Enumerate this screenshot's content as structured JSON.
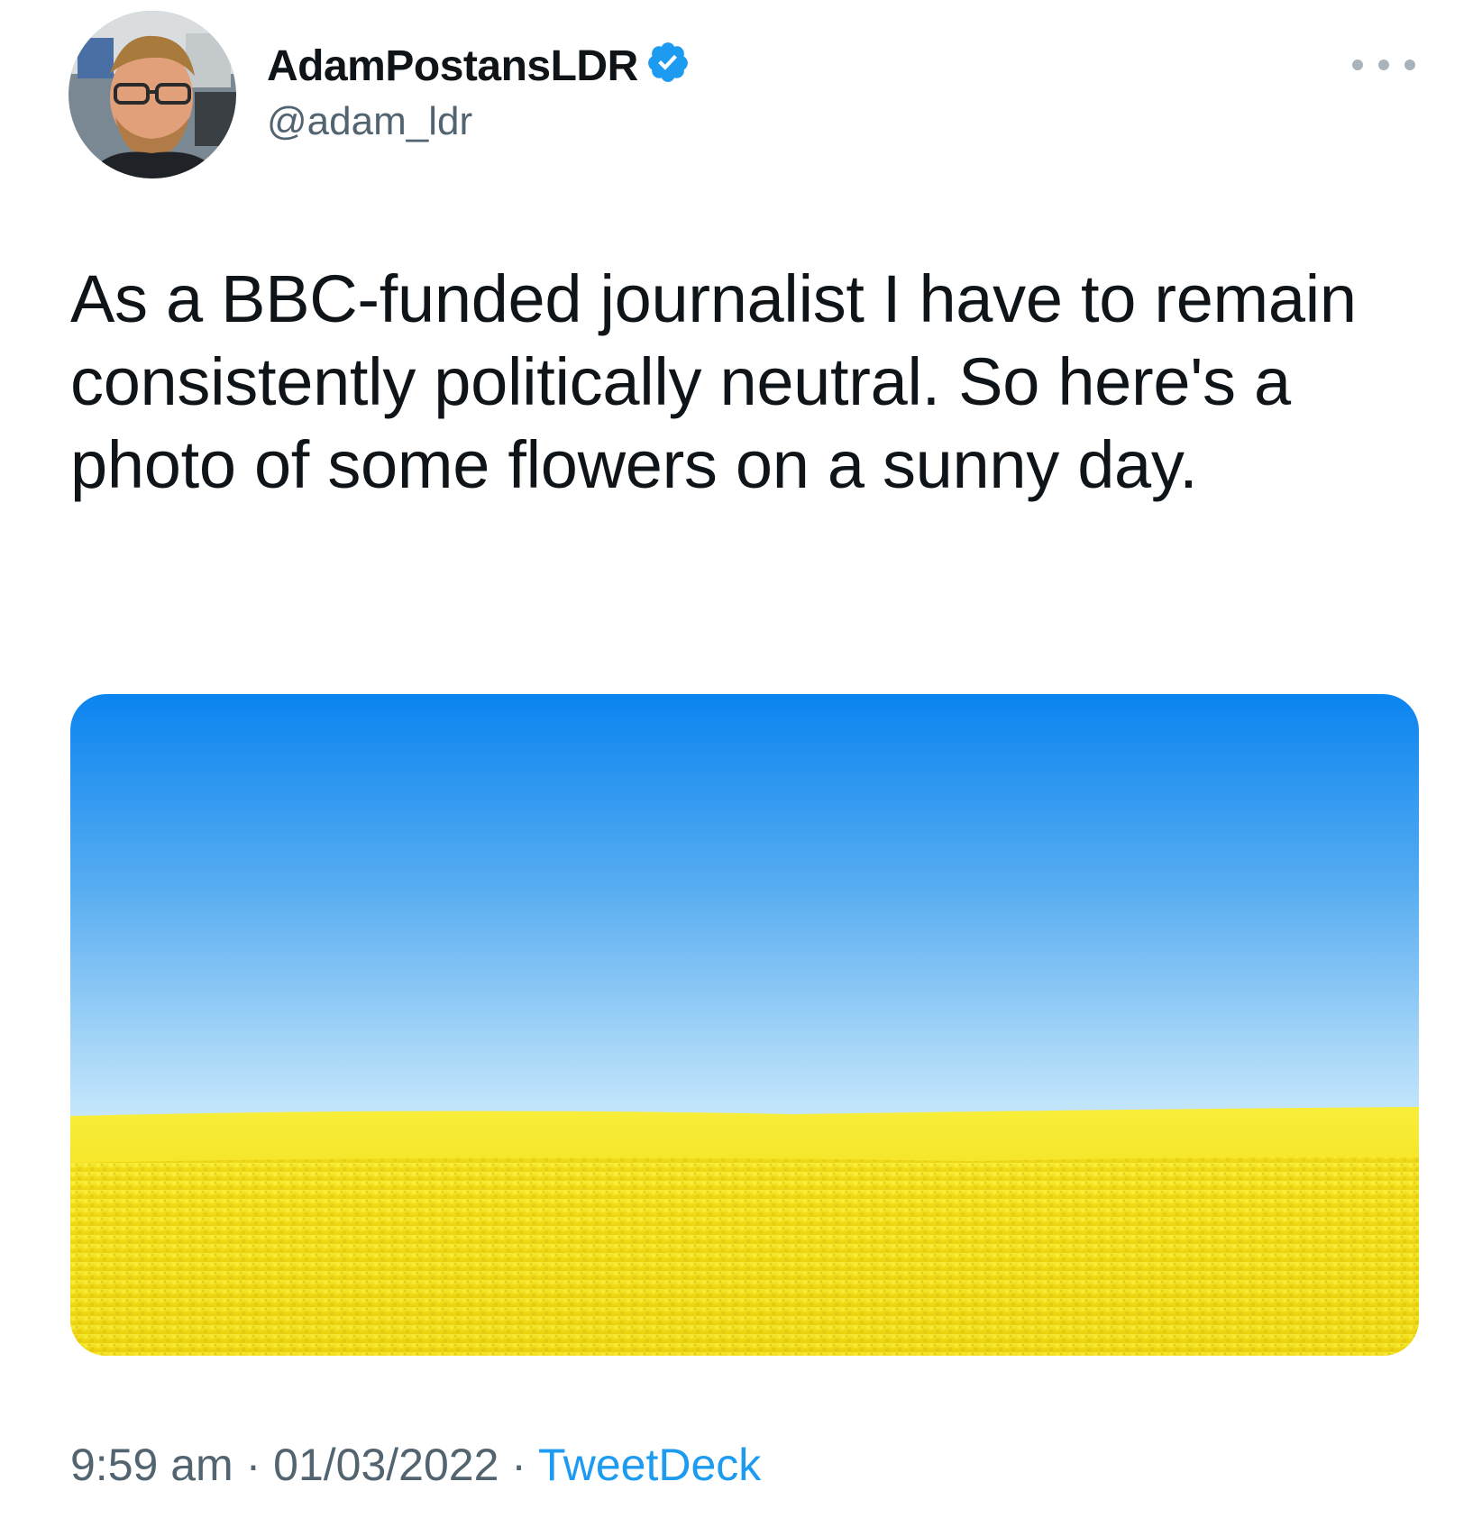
{
  "user": {
    "display_name": "AdamPostansLDR",
    "handle": "@adam_ldr",
    "verified": true
  },
  "tweet": {
    "text": "As a BBC-funded journalist I have to remain consistently politically neutral. So here's a photo of some flowers on a sunny day.",
    "time": "9:59 am",
    "separator": "·",
    "date": "01/03/2022",
    "source": "TweetDeck"
  },
  "icons": {
    "verified": "verified-badge-icon",
    "more": "more-options-icon"
  },
  "colors": {
    "text_primary": "#0f1419",
    "text_secondary": "#536471",
    "link": "#1d9bf0",
    "verified": "#1d9bf0",
    "sky_top": "#0a84f0",
    "sky_bottom": "#bfe4fb",
    "field": "#f4e21a"
  }
}
